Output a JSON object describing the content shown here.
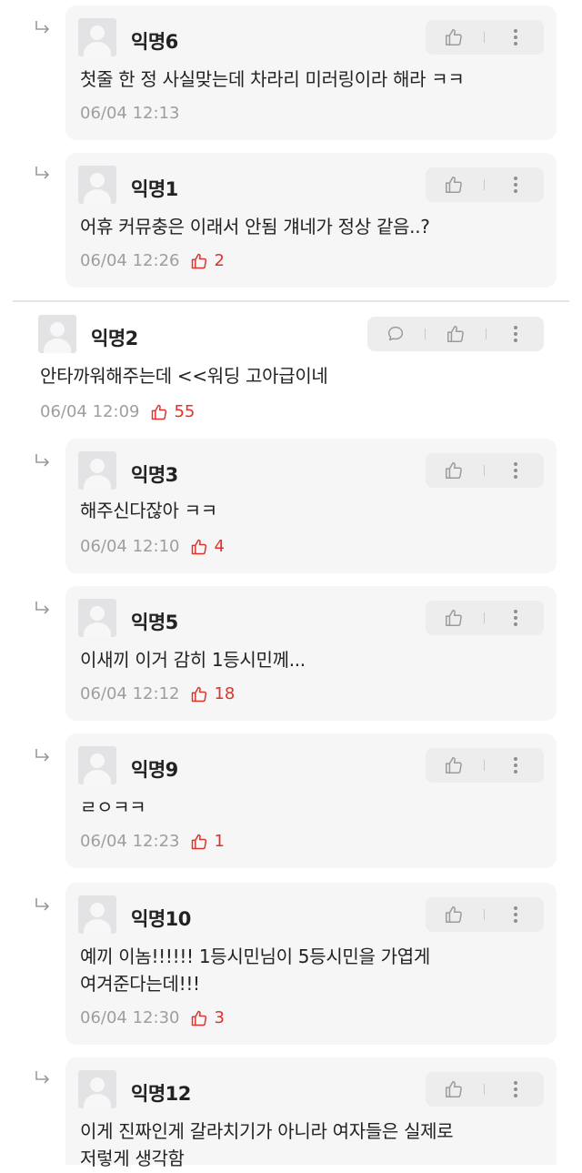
{
  "comments": [
    {
      "author": "익명6",
      "text": "첫줄 한 정 사실맞는데 차라리 미러링이라 해라 ㅋㅋ",
      "time": "06/04 12:13",
      "likes": null
    },
    {
      "author": "익명1",
      "text": "어휴 커뮤충은 이래서 안됨 걔네가 정상 같음..?",
      "time": "06/04 12:26",
      "likes": "2"
    },
    {
      "author": "익명2",
      "text": "안타까워해주는데 <<워딩 고아급이네",
      "time": "06/04 12:09",
      "likes": "55"
    },
    {
      "author": "익명3",
      "text": "해주신다잖아 ㅋㅋ",
      "time": "06/04 12:10",
      "likes": "4"
    },
    {
      "author": "익명5",
      "text": "이새끼 이거 감히 1등시민께...",
      "time": "06/04 12:12",
      "likes": "18"
    },
    {
      "author": "익명9",
      "text": "ㄹㅇㅋㅋ",
      "time": "06/04 12:23",
      "likes": "1"
    },
    {
      "author": "익명10",
      "text": "예끼 이놈!!!!!! 1등시민님이 5등시민을 가엽게",
      "text2": "여겨준다는데!!!",
      "time": "06/04 12:30",
      "likes": "3"
    },
    {
      "author": "익명12",
      "text": "이게 진짜인게 갈라치기가 아니라 여자들은 실제로",
      "text2": "저렇게 생각함",
      "time": null,
      "likes": null
    }
  ],
  "icons": {
    "like": "thumbs-up-icon",
    "more": "more-vertical-icon",
    "reply": "speech-bubble-icon",
    "reply_arrow": "reply-arrow-icon",
    "avatar": "default-avatar-icon"
  },
  "colors": {
    "like_count": "#e0322a",
    "muted": "#9e9e9e",
    "card_bg": "#f6f6f6"
  }
}
